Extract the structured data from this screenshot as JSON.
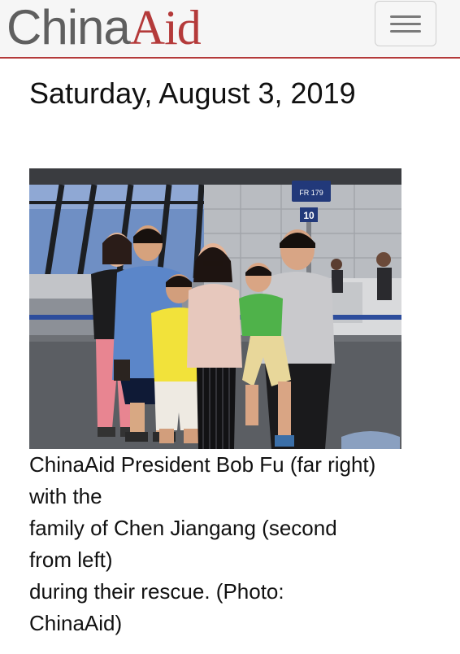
{
  "header": {
    "logo_part1": "China",
    "logo_part2": "Aid",
    "menu_icon": "hamburger-menu-icon"
  },
  "post": {
    "date": "Saturday, August 3, 2019",
    "photo_sign_label": "FR 179",
    "photo_gate_number": "10",
    "caption_lines": [
      "ChinaAid President Bob Fu (far right)",
      "with the",
      "family of Chen Jiangang (second",
      "from left)",
      "during their rescue. (Photo:",
      "ChinaAid)"
    ]
  },
  "colors": {
    "brand_red": "#b43a3a",
    "logo_gray": "#5f5f5f",
    "header_bg": "#f6f6f6"
  }
}
